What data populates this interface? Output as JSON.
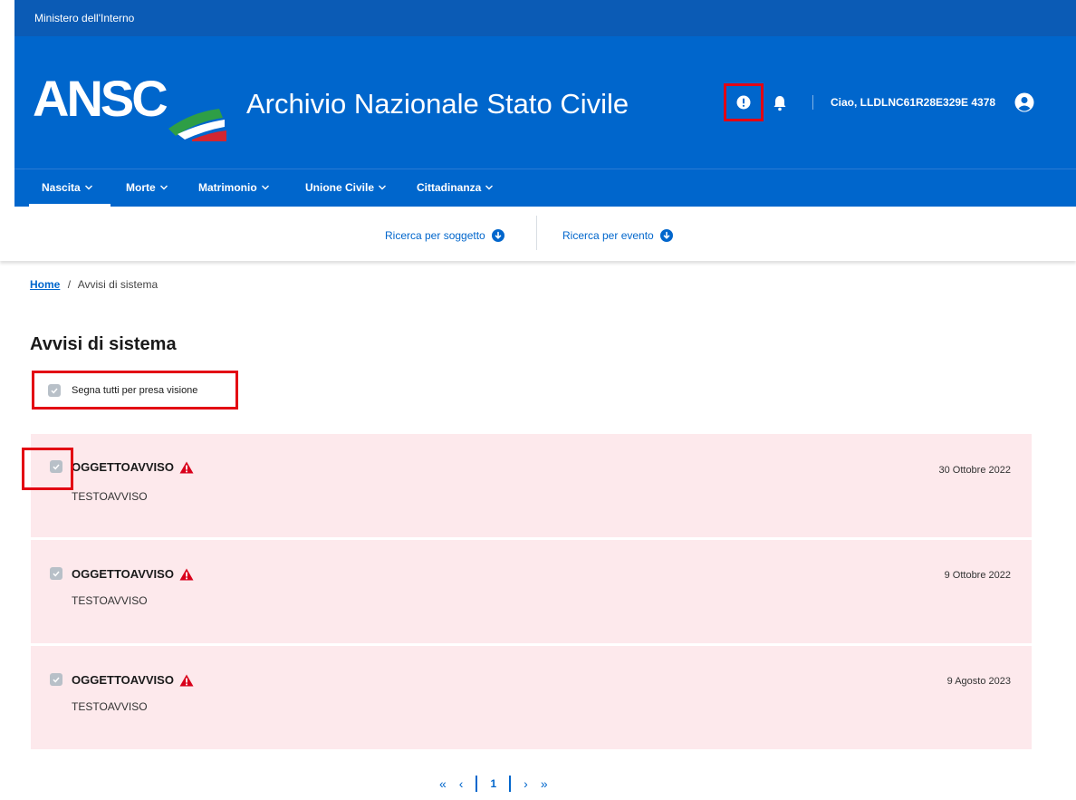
{
  "top_strip": {
    "text": "Ministero dell'Interno"
  },
  "header": {
    "logo_text": "ANSC",
    "title": "Archivio Nazionale Stato Civile",
    "greeting": "Ciao, LLDLNC61R28E329E 4378",
    "alert_icon": "exclamation-circle-icon",
    "bell_icon": "bell-icon",
    "user_icon": "user-circle-icon"
  },
  "nav": {
    "items": [
      {
        "label": "Nascita"
      },
      {
        "label": "Morte"
      },
      {
        "label": "Matrimonio"
      },
      {
        "label": "Unione Civile"
      },
      {
        "label": "Cittadinanza"
      }
    ],
    "active": "Nascita"
  },
  "subnav": {
    "links": [
      {
        "label": "Ricerca per soggetto"
      },
      {
        "label": "Ricerca per evento"
      }
    ]
  },
  "breadcrumb": {
    "home": "Home",
    "separator": "/",
    "current": "Avvisi di sistema"
  },
  "page_title": "Avvisi di sistema",
  "mark_all_label": "Segna tutti per presa visione",
  "notices": [
    {
      "title": "OGGETTOAVVISO",
      "text": "TESTOAVVISO",
      "date": "30 Ottobre 2022"
    },
    {
      "title": "OGGETTOAVVISO",
      "text": "TESTOAVVISO",
      "date": "9 Ottobre 2022"
    },
    {
      "title": "OGGETTOAVVISO",
      "text": "TESTOAVVISO",
      "date": "9 Agosto 2023"
    }
  ],
  "pagination": {
    "first": "«",
    "prev": "‹",
    "current": "1",
    "next": "›",
    "last": "»"
  },
  "colors": {
    "primary": "#0066cc",
    "strip": "#0b5bb5",
    "notice_bg": "#fde9ec",
    "warning": "#d9001b",
    "highlight": "#e30613"
  }
}
